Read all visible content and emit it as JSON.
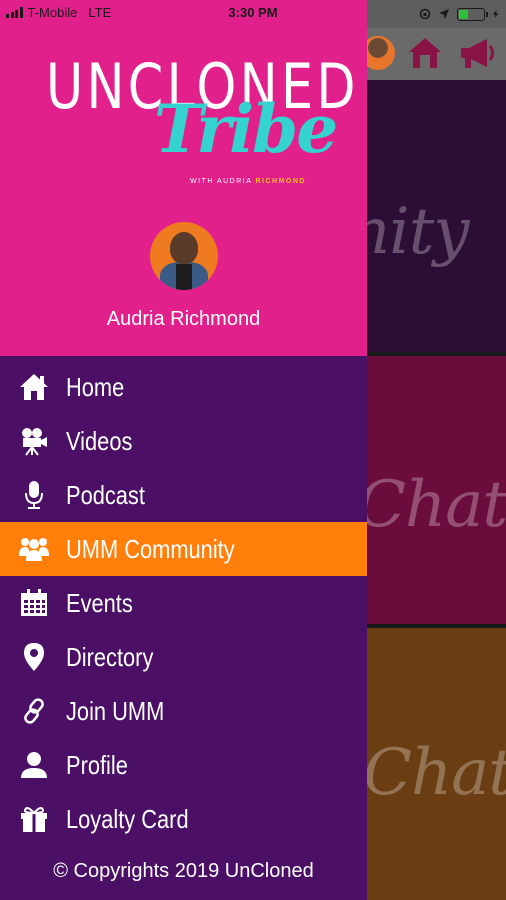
{
  "status_bar": {
    "carrier": "T-Mobile",
    "network": "LTE",
    "time": "3:30 PM",
    "battery_percent": 40
  },
  "background": {
    "tile_texts": [
      "nity",
      "Chat",
      "Chat"
    ]
  },
  "drawer": {
    "logo": {
      "line1": "UNCLONED",
      "line2": "Tribe",
      "tagline_prefix": "WITH AUDRIA ",
      "tagline_highlight": "RICHMOND"
    },
    "profile_name": "Audria Richmond",
    "menu": [
      {
        "label": "Home",
        "icon": "home-icon",
        "active": false
      },
      {
        "label": "Videos",
        "icon": "video-camera-icon",
        "active": false
      },
      {
        "label": "Podcast",
        "icon": "microphone-icon",
        "active": false
      },
      {
        "label": "UMM Community",
        "icon": "users-icon",
        "active": true
      },
      {
        "label": "Events",
        "icon": "calendar-icon",
        "active": false
      },
      {
        "label": "Directory",
        "icon": "map-pin-icon",
        "active": false
      },
      {
        "label": "Join UMM",
        "icon": "link-icon",
        "active": false
      },
      {
        "label": "Profile",
        "icon": "user-icon",
        "active": false
      },
      {
        "label": "Loyalty Card",
        "icon": "gift-icon",
        "active": false
      }
    ],
    "copyright": "© Copyrights 2019 UnCloned"
  },
  "colors": {
    "header_pink": "#e1208c",
    "menu_purple": "#4b0f66",
    "active_orange": "#ff7f0a",
    "logo_teal": "#35d3cf"
  }
}
